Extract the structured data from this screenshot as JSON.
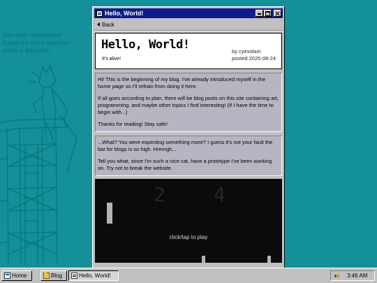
{
  "site_note": {
    "lines": [
      "Site under construction!",
      "Expect the site to look less",
      "empty in the future."
    ]
  },
  "window": {
    "title": "Hello, World!",
    "icon": "document-icon",
    "controls": [
      "minimize-icon",
      "maximize-icon",
      "close-icon"
    ],
    "back_label": "Back"
  },
  "post": {
    "title": "Hello, World!",
    "subtitle": "It's alive!",
    "author": "by cyexolam",
    "date": "posted 2025-08-24"
  },
  "body": {
    "block1": [
      "Hi! This is the beginning of my blog. I've already introduced myself in the home page so I'll refrain from doing it here.",
      "If all goes according to plan, there will be blog posts on this site containing art, programming, and maybe other topics I find interesting! (If I have the time to begin with...)",
      "Thanks for reading! Stay safe!"
    ],
    "block2": [
      "...What? You were expecting something more? I guess it's not your fault the bar for blogs is so high. Hrmngh...",
      "Tell you what, since I'm such a nice cat, have a prototype I've been working on. Try not to break the website."
    ]
  },
  "game": {
    "score_left": "2",
    "score_right": "4",
    "prompt": "click/tap to play"
  },
  "taskbar": {
    "items": [
      {
        "label": "Home",
        "icon": "home-icon"
      },
      {
        "label": "Blog",
        "icon": "folder-icon"
      },
      {
        "label": "Hello, World!",
        "icon": "document-icon"
      }
    ],
    "clock": "3:46 AM",
    "tray_icon": "speaker-icon"
  },
  "colors": {
    "desktop": "#13909a",
    "titlebar": "#0a1d8a",
    "content_bg": "#b8b4c2",
    "game_bg": "#0b0b0e"
  }
}
